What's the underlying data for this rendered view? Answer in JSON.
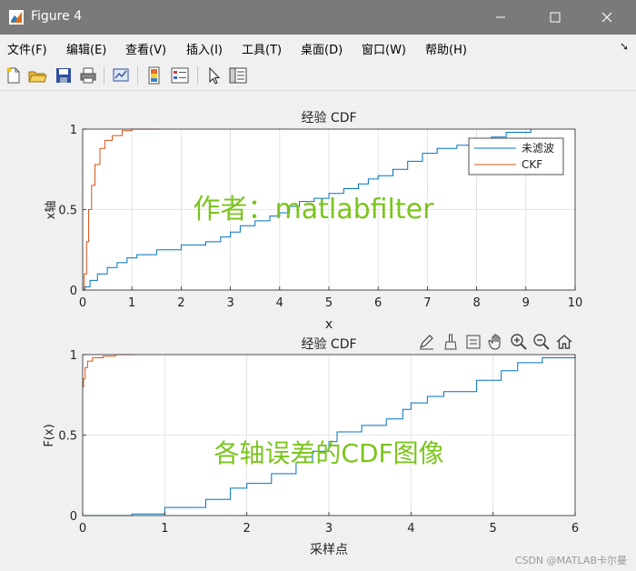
{
  "window": {
    "title": "Figure 4"
  },
  "menu": [
    {
      "label": "文件(F)",
      "key": "F"
    },
    {
      "label": "编辑(E)",
      "key": "E"
    },
    {
      "label": "查看(V)",
      "key": "V"
    },
    {
      "label": "插入(I)",
      "key": "I"
    },
    {
      "label": "工具(T)",
      "key": "T"
    },
    {
      "label": "桌面(D)",
      "key": "D"
    },
    {
      "label": "窗口(W)",
      "key": "W"
    },
    {
      "label": "帮助(H)",
      "key": "H"
    }
  ],
  "toolbar_icons": [
    "new-figure-icon",
    "open-file-icon",
    "save-icon",
    "print-icon",
    "link-plot-icon",
    "insert-colorbar-icon",
    "insert-legend-icon",
    "select-pointer-icon",
    "property-inspector-icon"
  ],
  "axes_toolbar_icons": [
    "brush-edit-icon",
    "data-brush-icon",
    "data-tips-icon",
    "pan-hand-icon",
    "zoom-in-icon",
    "zoom-out-icon",
    "home-restore-icon"
  ],
  "colors": {
    "blue": "#0072BD",
    "orange": "#D95319",
    "watermark": "#7cc41e"
  },
  "chart_data": [
    {
      "type": "line",
      "title": "经验 CDF",
      "xlabel": "x",
      "ylabel": "x轴",
      "xlim": [
        0,
        10
      ],
      "ylim": [
        0,
        1
      ],
      "xticks": [
        0,
        1,
        2,
        3,
        4,
        5,
        6,
        7,
        8,
        9,
        10
      ],
      "yticks": [
        0,
        0.5,
        1
      ],
      "grid": true,
      "legend": {
        "placement": "top-right",
        "entries": [
          "未滤波",
          "CKF"
        ]
      },
      "annotation": "作者：matlabfilter",
      "series": [
        {
          "name": "未滤波",
          "color": "#0072BD",
          "points": [
            [
              0,
              0
            ],
            [
              0.05,
              0.02
            ],
            [
              0.15,
              0.06
            ],
            [
              0.3,
              0.1
            ],
            [
              0.5,
              0.14
            ],
            [
              0.7,
              0.17
            ],
            [
              0.9,
              0.2
            ],
            [
              1.1,
              0.22
            ],
            [
              1.5,
              0.25
            ],
            [
              2,
              0.28
            ],
            [
              2.5,
              0.3
            ],
            [
              2.8,
              0.33
            ],
            [
              3,
              0.36
            ],
            [
              3.2,
              0.4
            ],
            [
              3.5,
              0.43
            ],
            [
              3.8,
              0.46
            ],
            [
              4,
              0.48
            ],
            [
              4.2,
              0.52
            ],
            [
              4.4,
              0.55
            ],
            [
              4.7,
              0.57
            ],
            [
              5,
              0.6
            ],
            [
              5.3,
              0.63
            ],
            [
              5.6,
              0.66
            ],
            [
              5.8,
              0.69
            ],
            [
              6,
              0.71
            ],
            [
              6.3,
              0.75
            ],
            [
              6.6,
              0.8
            ],
            [
              6.9,
              0.85
            ],
            [
              7.2,
              0.88
            ],
            [
              7.6,
              0.9
            ],
            [
              8,
              0.92
            ],
            [
              8.3,
              0.95
            ],
            [
              8.6,
              0.98
            ],
            [
              9.1,
              1
            ]
          ]
        },
        {
          "name": "CKF",
          "color": "#D95319",
          "points": [
            [
              0,
              0
            ],
            [
              0.03,
              0.1
            ],
            [
              0.08,
              0.3
            ],
            [
              0.12,
              0.5
            ],
            [
              0.18,
              0.65
            ],
            [
              0.25,
              0.78
            ],
            [
              0.35,
              0.88
            ],
            [
              0.45,
              0.93
            ],
            [
              0.6,
              0.96
            ],
            [
              0.8,
              0.99
            ],
            [
              1,
              1
            ],
            [
              1.55,
              1
            ]
          ]
        }
      ]
    },
    {
      "type": "line",
      "title": "经验 CDF",
      "xlabel": "采样点",
      "ylabel": "F(x)",
      "xlim": [
        0,
        6
      ],
      "ylim": [
        0,
        1
      ],
      "xticks": [
        0,
        1,
        2,
        3,
        4,
        5,
        6
      ],
      "yticks": [
        0,
        0.5,
        1
      ],
      "grid": true,
      "annotation": "各轴误差的CDF图像",
      "series": [
        {
          "color": "#0072BD",
          "points": [
            [
              0,
              0
            ],
            [
              0.5,
              0
            ],
            [
              0.6,
              0.01
            ],
            [
              1,
              0.05
            ],
            [
              1.3,
              0.05
            ],
            [
              1.5,
              0.1
            ],
            [
              1.8,
              0.17
            ],
            [
              2,
              0.2
            ],
            [
              2.3,
              0.26
            ],
            [
              2.6,
              0.33
            ],
            [
              2.8,
              0.4
            ],
            [
              3,
              0.46
            ],
            [
              3.1,
              0.52
            ],
            [
              3.4,
              0.56
            ],
            [
              3.7,
              0.6
            ],
            [
              3.9,
              0.66
            ],
            [
              4,
              0.7
            ],
            [
              4.2,
              0.74
            ],
            [
              4.4,
              0.77
            ],
            [
              4.8,
              0.84
            ],
            [
              5.1,
              0.9
            ],
            [
              5.3,
              0.95
            ],
            [
              5.6,
              0.98
            ],
            [
              6,
              1
            ]
          ]
        },
        {
          "color": "#D95319",
          "points": [
            [
              0,
              0.8
            ],
            [
              0.01,
              0.85
            ],
            [
              0.03,
              0.92
            ],
            [
              0.06,
              0.96
            ],
            [
              0.12,
              0.98
            ],
            [
              0.25,
              0.99
            ],
            [
              0.4,
              1
            ],
            [
              0.63,
              1
            ]
          ]
        }
      ]
    }
  ],
  "watermark": "CSDN @MATLAB卡尔曼"
}
